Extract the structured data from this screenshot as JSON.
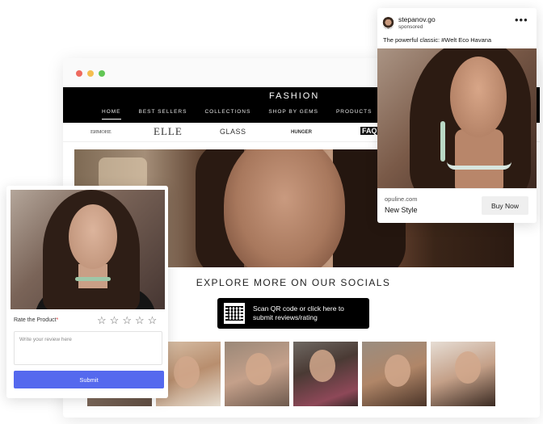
{
  "site": {
    "title": "FASHION",
    "nav": [
      "HOME",
      "BEST SELLERS",
      "COLLECTIONS",
      "SHOP BY GEMS",
      "PRODUCTS"
    ],
    "brands": [
      "ЕИМОНЕ",
      "ELLE",
      "GLASS",
      "HUNGER",
      "FAQ"
    ]
  },
  "socials": {
    "heading": "EXPLORE MORE ON OUR SOCIALS",
    "qr_button_label": "Scan QR code or click here to submit reviews/rating"
  },
  "review_form": {
    "rate_label": "Rate the Product",
    "required_mark": "*",
    "stars": [
      "☆",
      "☆",
      "☆",
      "☆",
      "☆"
    ],
    "review_placeholder": "Write your review here",
    "submit_label": "Submit",
    "accent_color": "#5569ee"
  },
  "ad": {
    "username": "stepanov.go",
    "sponsored_label": "sponsored",
    "more_icon": "•••",
    "caption": "The powerful classic: #Welt Eco Havana",
    "domain": "opuline.com",
    "headline": "New Style",
    "cta_label": "Buy Now"
  },
  "window_controls": [
    "close",
    "minimize",
    "maximize"
  ]
}
